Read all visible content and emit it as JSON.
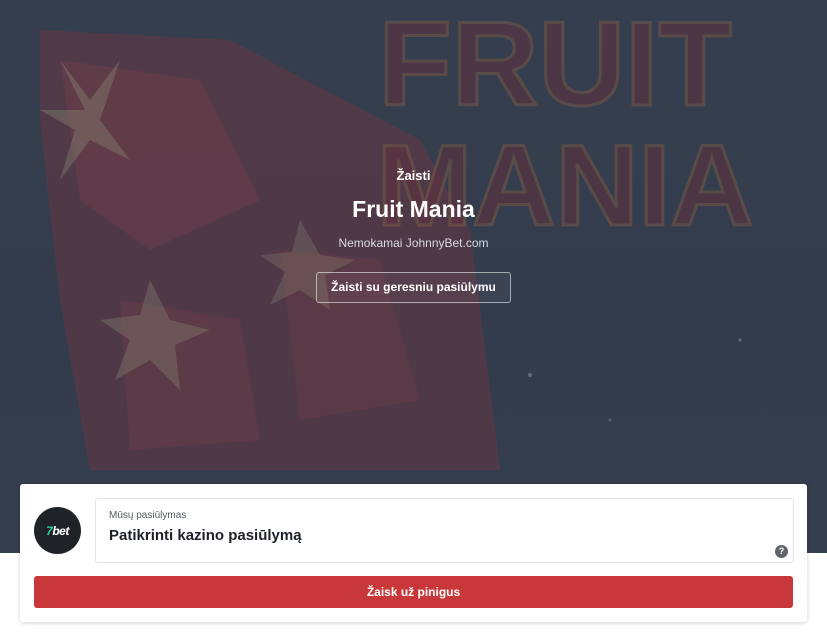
{
  "hero": {
    "background_word_1": "FRUIT",
    "background_word_2": "MANIA",
    "eyebrow": "Žaisti",
    "title": "Fruit Mania",
    "subtitle": "Nemokamai JohnnyBet.com",
    "cta_label": "Žaisti su geresniu pasiūlymu"
  },
  "offer": {
    "logo_text_number": "7",
    "logo_text_brand": "bet",
    "label": "Mūsų pasiūlymas",
    "value": "Patikrinti kazino pasiūlymą",
    "help_icon": "question-circle-icon",
    "play_label": "Žaisk už pinigus"
  },
  "colors": {
    "accent_red": "#c8383a",
    "hero_bg": "#3d4656",
    "logo_bg": "#1f2328",
    "logo_accent": "#28d6a3"
  }
}
